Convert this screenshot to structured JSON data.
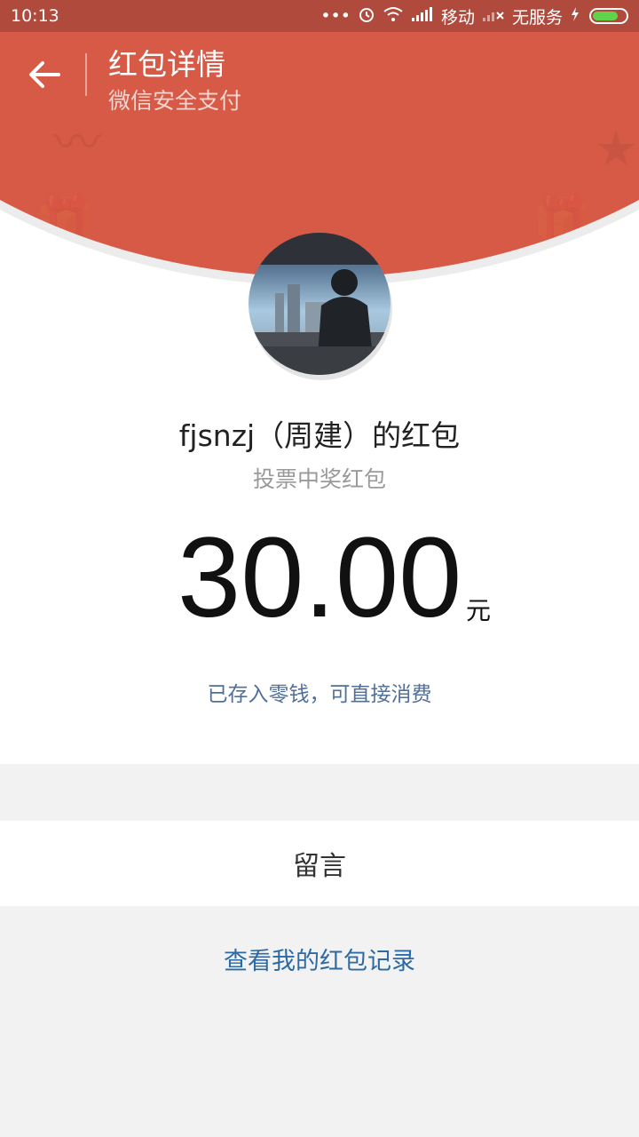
{
  "status_bar": {
    "time": "10:13",
    "dots": "•••",
    "carrier": "移动",
    "no_service": "无服务",
    "icons": [
      "alarm-icon",
      "wifi-icon",
      "signal-icon",
      "signal-off-icon",
      "charging-icon",
      "battery-icon"
    ]
  },
  "header": {
    "title": "红包详情",
    "subtitle": "微信安全支付",
    "color": "#d65a46"
  },
  "packet": {
    "sender": "fjsnzj（周建）的红包",
    "wish": "投票中奖红包",
    "amount": "30.00",
    "currency": "元",
    "deposit_note": "已存入零钱，可直接消费"
  },
  "actions": {
    "message_label": "留言",
    "records_link": "查看我的红包记录"
  }
}
